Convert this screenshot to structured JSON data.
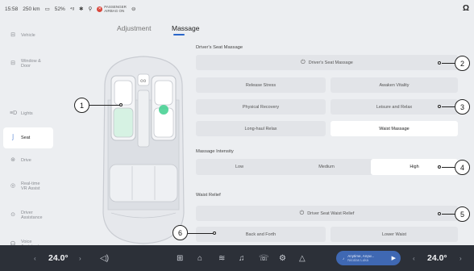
{
  "status": {
    "time": "15:58",
    "range": "250 km",
    "battery": "52%",
    "airbag_line1": "PASSENGER",
    "airbag_line2": "AIRBAG ON"
  },
  "sidebar": {
    "items": [
      {
        "label": "Vehicle",
        "icon": "car-icon"
      },
      {
        "label": "Window & Door",
        "icon": "window-icon"
      },
      {
        "label": "Lights",
        "icon": "lights-icon"
      },
      {
        "label": "Seat",
        "icon": "seat-icon"
      },
      {
        "label": "Drive",
        "icon": "steering-icon"
      },
      {
        "label": "Real-time VR Assist",
        "icon": "vr-icon"
      },
      {
        "label": "Driver Assistance",
        "icon": "driver-assist-icon"
      },
      {
        "label": "Voice Assistant",
        "icon": "voice-icon"
      }
    ],
    "active_index": 3
  },
  "tabs": [
    "Adjustment",
    "Massage"
  ],
  "active_tab": "Massage",
  "massage": {
    "title": "Driver's Seat Massage",
    "power_label": "Driver's Seat Massage",
    "modes": [
      "Release Stress",
      "Awaken Vitality",
      "Physical Recovery",
      "Leisure and Relax",
      "Long-haul Relax",
      "Waist Massage"
    ],
    "selected_mode": "Waist Massage"
  },
  "intensity": {
    "title": "Massage Intensity",
    "options": [
      "Low",
      "Medium",
      "High"
    ],
    "selected": "High"
  },
  "waist": {
    "title": "Waist Relief",
    "power_label": "Driver Seat Waist Relief",
    "options": [
      "Back and Forth",
      "Lower Waist"
    ]
  },
  "callouts": [
    "1",
    "2",
    "3",
    "4",
    "5",
    "6"
  ],
  "bottom": {
    "left_temp": "24.0°",
    "right_temp": "24.0°",
    "media_title": "Anytime, Anyw...",
    "media_subtitle": "Nicolas Luka"
  },
  "colors": {
    "accent": "#2a66c9",
    "seat_active": "#3ecf8e",
    "bottom_bar": "#2c3038"
  }
}
